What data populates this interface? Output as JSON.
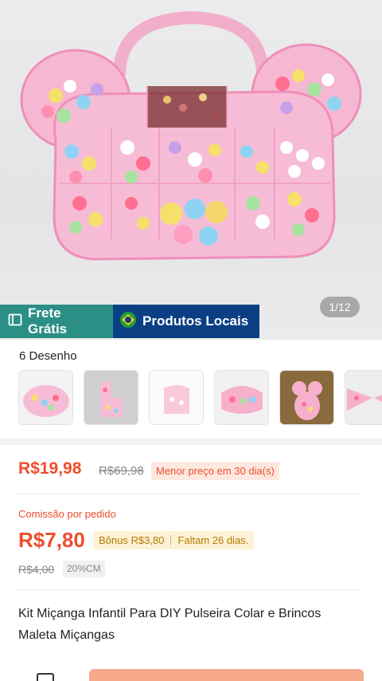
{
  "gallery": {
    "counter": "1/12",
    "badges": [
      {
        "label": "Frete Grátis",
        "icon": "truck-box-icon"
      },
      {
        "label": "Produtos Locais",
        "icon": "brazil-flag-icon"
      }
    ]
  },
  "variants": {
    "title": "6 Desenho",
    "items": [
      "variant-1",
      "variant-2",
      "variant-3",
      "variant-4",
      "variant-5",
      "variant-6"
    ]
  },
  "price": {
    "current": "R$19,98",
    "original": "R$69,98",
    "tag": "Menor preço em 30 dia(s)"
  },
  "commission": {
    "label": "Comissão por pedido",
    "value": "R$7,80",
    "bonus": "Bônus R$3,80",
    "remaining": "Faltam 26 dias.",
    "old_value": "R$4,00",
    "percent": "20%CM"
  },
  "product": {
    "title": "Kit Miçanga Infantil Para DIY Pulseira Colar e Brincos Maleta Miçangas"
  },
  "colors": {
    "accent": "#ee4d2d",
    "frete_badge": "#2b8f86",
    "local_badge": "#0a3f84",
    "cta": "#f7a98b"
  }
}
